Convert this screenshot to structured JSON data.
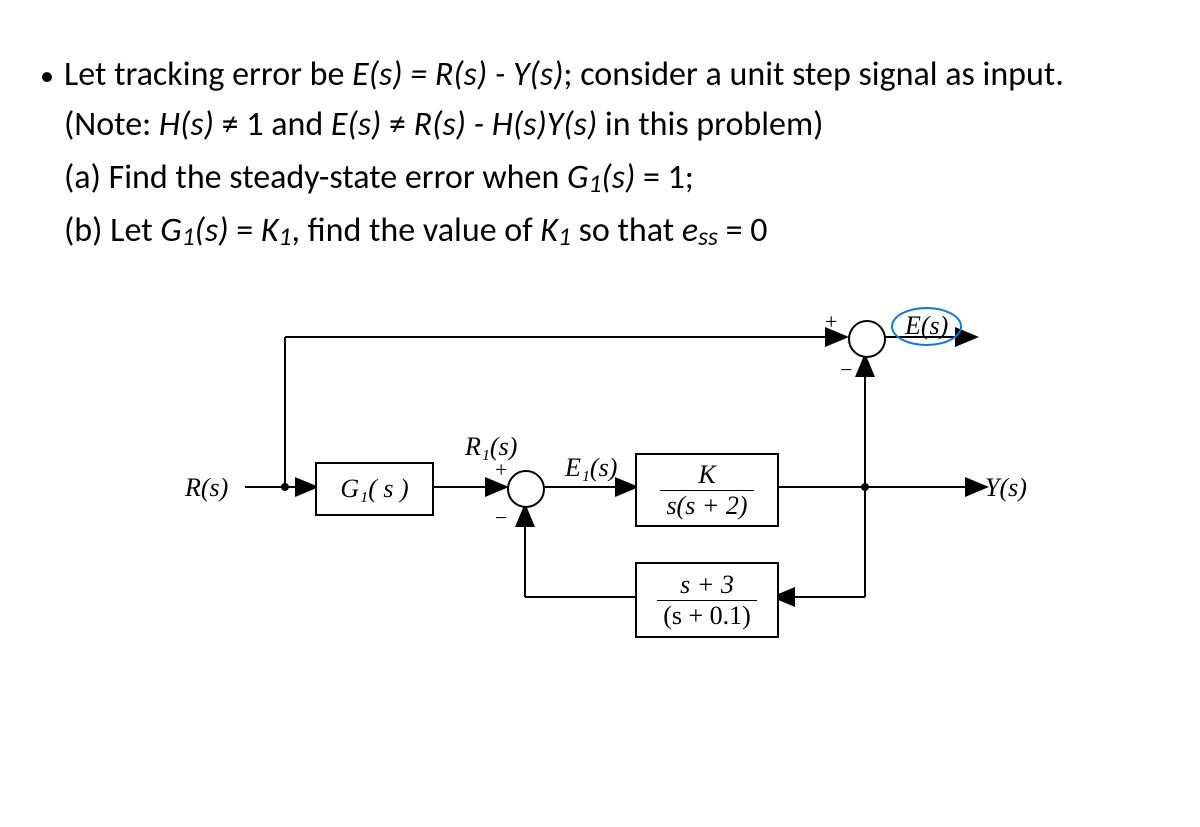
{
  "bullet": {
    "text_a": "Let tracking error be ",
    "eq1": "E(s) = R(s) - Y(s)",
    "text_b": "; consider a unit step signal as input."
  },
  "note": {
    "prefix": "(Note: ",
    "hs": "H(s)",
    "neq1": " ≠ 1 and ",
    "es": "E(s)",
    "neq2": " ≠ ",
    "rhs": "R(s) - H(s)Y(s)",
    "suffix": " in this problem)"
  },
  "part_a": {
    "prefix": "(a) Find the steady-state error when ",
    "g1": "G",
    "sub": "1",
    "paren": "(s)",
    "eq": " = 1;"
  },
  "part_b": {
    "prefix": "(b) Let ",
    "g1": "G",
    "sub1": "1",
    "paren": "(s)",
    "mid": " = ",
    "k": "K",
    "sub2": "1",
    "mid2": ", find the value of ",
    "k2": "K",
    "sub3": "1",
    "mid3": " so that ",
    "ess": "e",
    "ess_sub": "ss",
    "end": " = 0"
  },
  "diagram": {
    "r_in": "R(s)",
    "g1_block": "G₁( s )",
    "r1": "R₁(s)",
    "e1": "E₁(s)",
    "plant_num": "K",
    "plant_den": "s(s + 2)",
    "fb_num": "s + 3",
    "fb_den": "(s + 0.1)",
    "y_out": "Y(s)",
    "e_out": "E(s)",
    "plus1": "+",
    "minus1": "−",
    "plus2": "+",
    "minus2": "−"
  }
}
